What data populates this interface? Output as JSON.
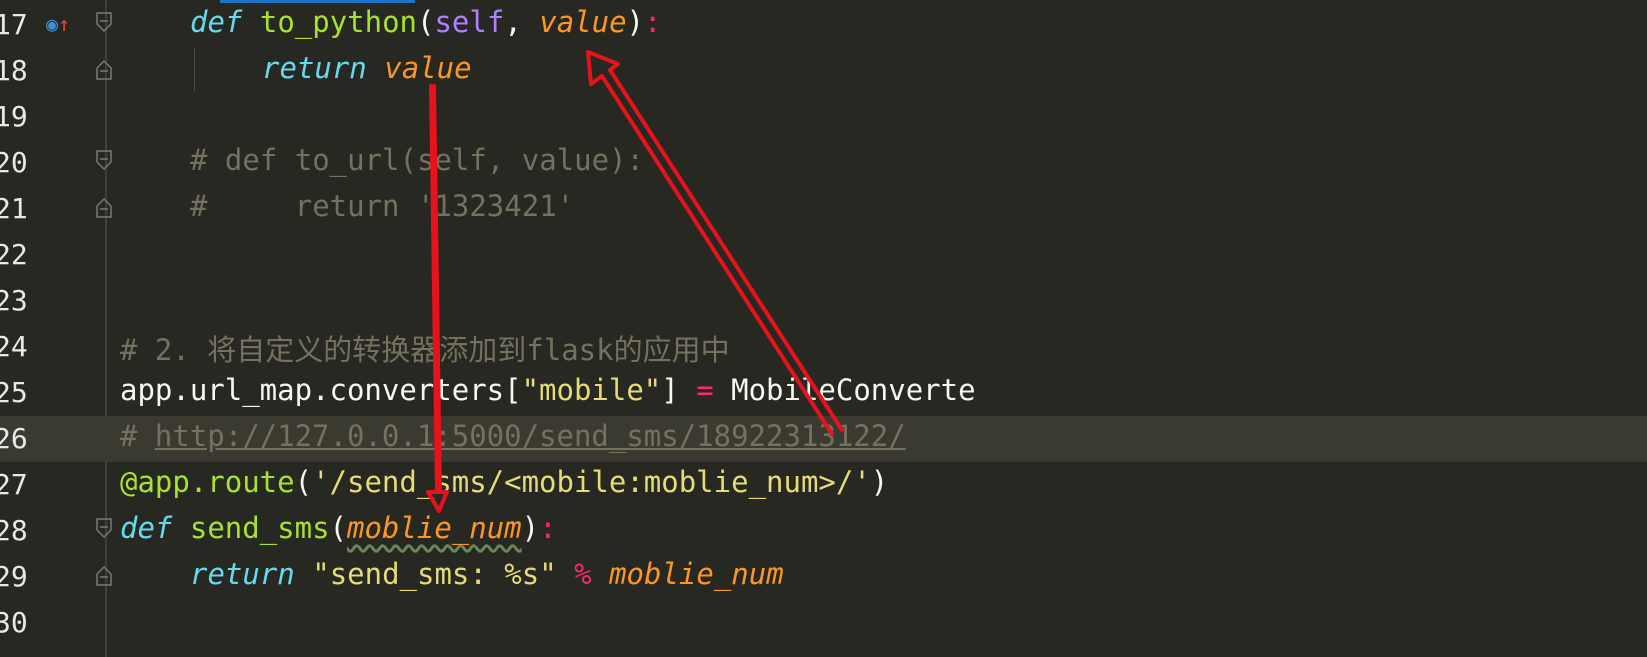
{
  "editor": {
    "lines": [
      {
        "num": "17",
        "tokens": [
          {
            "cls": "kw",
            "text": "def"
          },
          {
            "cls": "plain",
            "text": " "
          },
          {
            "cls": "fn",
            "text": "to_python"
          },
          {
            "cls": "plain",
            "text": "("
          },
          {
            "cls": "selfkw",
            "text": "self"
          },
          {
            "cls": "plain",
            "text": ", "
          },
          {
            "cls": "param",
            "text": "value"
          },
          {
            "cls": "plain",
            "text": ")"
          },
          {
            "cls": "op",
            "text": ":"
          }
        ]
      },
      {
        "num": "18",
        "tokens": [
          {
            "cls": "kw",
            "text": "return"
          },
          {
            "cls": "plain",
            "text": " "
          },
          {
            "cls": "param",
            "text": "value"
          }
        ]
      },
      {
        "num": "19",
        "tokens": []
      },
      {
        "num": "20",
        "tokens": [
          {
            "cls": "cm",
            "text": "# def to_url(self, value):"
          }
        ]
      },
      {
        "num": "21",
        "tokens": [
          {
            "cls": "cm",
            "text": "#     return '1323421'"
          }
        ]
      },
      {
        "num": "22",
        "tokens": []
      },
      {
        "num": "23",
        "tokens": []
      },
      {
        "num": "24",
        "tokens": [
          {
            "cls": "cm",
            "text": "# 2. 将自定义的转换器添加到flask的应用中"
          }
        ]
      },
      {
        "num": "25",
        "tokens": [
          {
            "cls": "plain",
            "text": "app.url_map.converters["
          },
          {
            "cls": "str",
            "text": "\"mobile\""
          },
          {
            "cls": "plain",
            "text": "] "
          },
          {
            "cls": "op",
            "text": "="
          },
          {
            "cls": "plain",
            "text": " MobileConverte"
          }
        ]
      },
      {
        "num": "26",
        "tokens": [
          {
            "cls": "cm",
            "text": "# "
          },
          {
            "cls": "link",
            "text": "http://127.0.0.1:5000/send_sms/18922313122/"
          }
        ]
      },
      {
        "num": "27",
        "tokens": [
          {
            "cls": "deco",
            "text": "@app.route"
          },
          {
            "cls": "plain",
            "text": "("
          },
          {
            "cls": "str",
            "text": "'/send_sms/<mobile:moblie_num>/'"
          },
          {
            "cls": "plain",
            "text": ")"
          }
        ]
      },
      {
        "num": "28",
        "tokens": [
          {
            "cls": "kw",
            "text": "def"
          },
          {
            "cls": "plain",
            "text": " "
          },
          {
            "cls": "fn",
            "text": "send_sms"
          },
          {
            "cls": "plain",
            "text": "("
          },
          {
            "cls": "param squiggle",
            "text": "moblie_num"
          },
          {
            "cls": "plain",
            "text": ")"
          },
          {
            "cls": "op",
            "text": ":"
          }
        ]
      },
      {
        "num": "29",
        "tokens": [
          {
            "cls": "kw",
            "text": "return"
          },
          {
            "cls": "plain",
            "text": " "
          },
          {
            "cls": "str",
            "text": "\"send_sms: %s\""
          },
          {
            "cls": "plain",
            "text": " "
          },
          {
            "cls": "op",
            "text": "%"
          },
          {
            "cls": "plain",
            "text": " "
          },
          {
            "cls": "param",
            "text": "moblie_num"
          }
        ]
      },
      {
        "num": "30",
        "tokens": []
      }
    ],
    "fold_lines": [
      "17",
      "18",
      "20",
      "21",
      "28",
      "29"
    ],
    "current_line": "26",
    "gutter_icon": "override-method-icon"
  },
  "colors": {
    "background": "#272822",
    "annotation_arrows": "#e8121c"
  }
}
